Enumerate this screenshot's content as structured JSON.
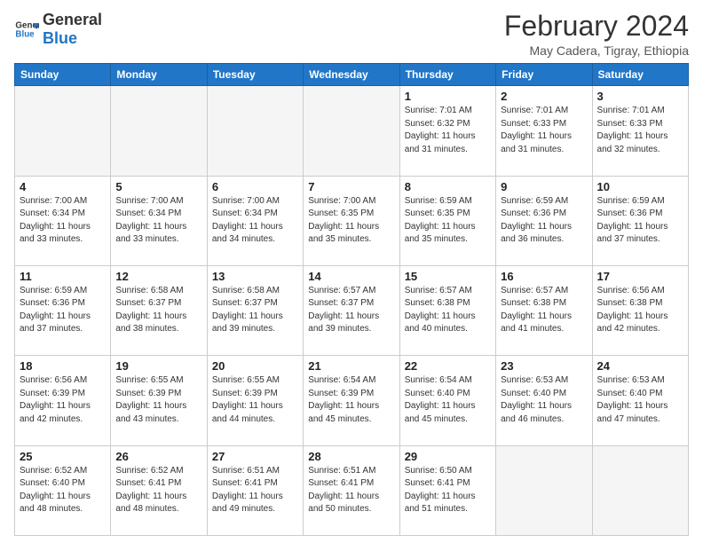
{
  "logo": {
    "line1": "General",
    "line2": "Blue"
  },
  "header": {
    "month": "February 2024",
    "location": "May Cadera, Tigray, Ethiopia"
  },
  "weekdays": [
    "Sunday",
    "Monday",
    "Tuesday",
    "Wednesday",
    "Thursday",
    "Friday",
    "Saturday"
  ],
  "weeks": [
    [
      {
        "day": "",
        "info": ""
      },
      {
        "day": "",
        "info": ""
      },
      {
        "day": "",
        "info": ""
      },
      {
        "day": "",
        "info": ""
      },
      {
        "day": "1",
        "info": "Sunrise: 7:01 AM\nSunset: 6:32 PM\nDaylight: 11 hours\nand 31 minutes."
      },
      {
        "day": "2",
        "info": "Sunrise: 7:01 AM\nSunset: 6:33 PM\nDaylight: 11 hours\nand 31 minutes."
      },
      {
        "day": "3",
        "info": "Sunrise: 7:01 AM\nSunset: 6:33 PM\nDaylight: 11 hours\nand 32 minutes."
      }
    ],
    [
      {
        "day": "4",
        "info": "Sunrise: 7:00 AM\nSunset: 6:34 PM\nDaylight: 11 hours\nand 33 minutes."
      },
      {
        "day": "5",
        "info": "Sunrise: 7:00 AM\nSunset: 6:34 PM\nDaylight: 11 hours\nand 33 minutes."
      },
      {
        "day": "6",
        "info": "Sunrise: 7:00 AM\nSunset: 6:34 PM\nDaylight: 11 hours\nand 34 minutes."
      },
      {
        "day": "7",
        "info": "Sunrise: 7:00 AM\nSunset: 6:35 PM\nDaylight: 11 hours\nand 35 minutes."
      },
      {
        "day": "8",
        "info": "Sunrise: 6:59 AM\nSunset: 6:35 PM\nDaylight: 11 hours\nand 35 minutes."
      },
      {
        "day": "9",
        "info": "Sunrise: 6:59 AM\nSunset: 6:36 PM\nDaylight: 11 hours\nand 36 minutes."
      },
      {
        "day": "10",
        "info": "Sunrise: 6:59 AM\nSunset: 6:36 PM\nDaylight: 11 hours\nand 37 minutes."
      }
    ],
    [
      {
        "day": "11",
        "info": "Sunrise: 6:59 AM\nSunset: 6:36 PM\nDaylight: 11 hours\nand 37 minutes."
      },
      {
        "day": "12",
        "info": "Sunrise: 6:58 AM\nSunset: 6:37 PM\nDaylight: 11 hours\nand 38 minutes."
      },
      {
        "day": "13",
        "info": "Sunrise: 6:58 AM\nSunset: 6:37 PM\nDaylight: 11 hours\nand 39 minutes."
      },
      {
        "day": "14",
        "info": "Sunrise: 6:57 AM\nSunset: 6:37 PM\nDaylight: 11 hours\nand 39 minutes."
      },
      {
        "day": "15",
        "info": "Sunrise: 6:57 AM\nSunset: 6:38 PM\nDaylight: 11 hours\nand 40 minutes."
      },
      {
        "day": "16",
        "info": "Sunrise: 6:57 AM\nSunset: 6:38 PM\nDaylight: 11 hours\nand 41 minutes."
      },
      {
        "day": "17",
        "info": "Sunrise: 6:56 AM\nSunset: 6:38 PM\nDaylight: 11 hours\nand 42 minutes."
      }
    ],
    [
      {
        "day": "18",
        "info": "Sunrise: 6:56 AM\nSunset: 6:39 PM\nDaylight: 11 hours\nand 42 minutes."
      },
      {
        "day": "19",
        "info": "Sunrise: 6:55 AM\nSunset: 6:39 PM\nDaylight: 11 hours\nand 43 minutes."
      },
      {
        "day": "20",
        "info": "Sunrise: 6:55 AM\nSunset: 6:39 PM\nDaylight: 11 hours\nand 44 minutes."
      },
      {
        "day": "21",
        "info": "Sunrise: 6:54 AM\nSunset: 6:39 PM\nDaylight: 11 hours\nand 45 minutes."
      },
      {
        "day": "22",
        "info": "Sunrise: 6:54 AM\nSunset: 6:40 PM\nDaylight: 11 hours\nand 45 minutes."
      },
      {
        "day": "23",
        "info": "Sunrise: 6:53 AM\nSunset: 6:40 PM\nDaylight: 11 hours\nand 46 minutes."
      },
      {
        "day": "24",
        "info": "Sunrise: 6:53 AM\nSunset: 6:40 PM\nDaylight: 11 hours\nand 47 minutes."
      }
    ],
    [
      {
        "day": "25",
        "info": "Sunrise: 6:52 AM\nSunset: 6:40 PM\nDaylight: 11 hours\nand 48 minutes."
      },
      {
        "day": "26",
        "info": "Sunrise: 6:52 AM\nSunset: 6:41 PM\nDaylight: 11 hours\nand 48 minutes."
      },
      {
        "day": "27",
        "info": "Sunrise: 6:51 AM\nSunset: 6:41 PM\nDaylight: 11 hours\nand 49 minutes."
      },
      {
        "day": "28",
        "info": "Sunrise: 6:51 AM\nSunset: 6:41 PM\nDaylight: 11 hours\nand 50 minutes."
      },
      {
        "day": "29",
        "info": "Sunrise: 6:50 AM\nSunset: 6:41 PM\nDaylight: 11 hours\nand 51 minutes."
      },
      {
        "day": "",
        "info": ""
      },
      {
        "day": "",
        "info": ""
      }
    ]
  ]
}
